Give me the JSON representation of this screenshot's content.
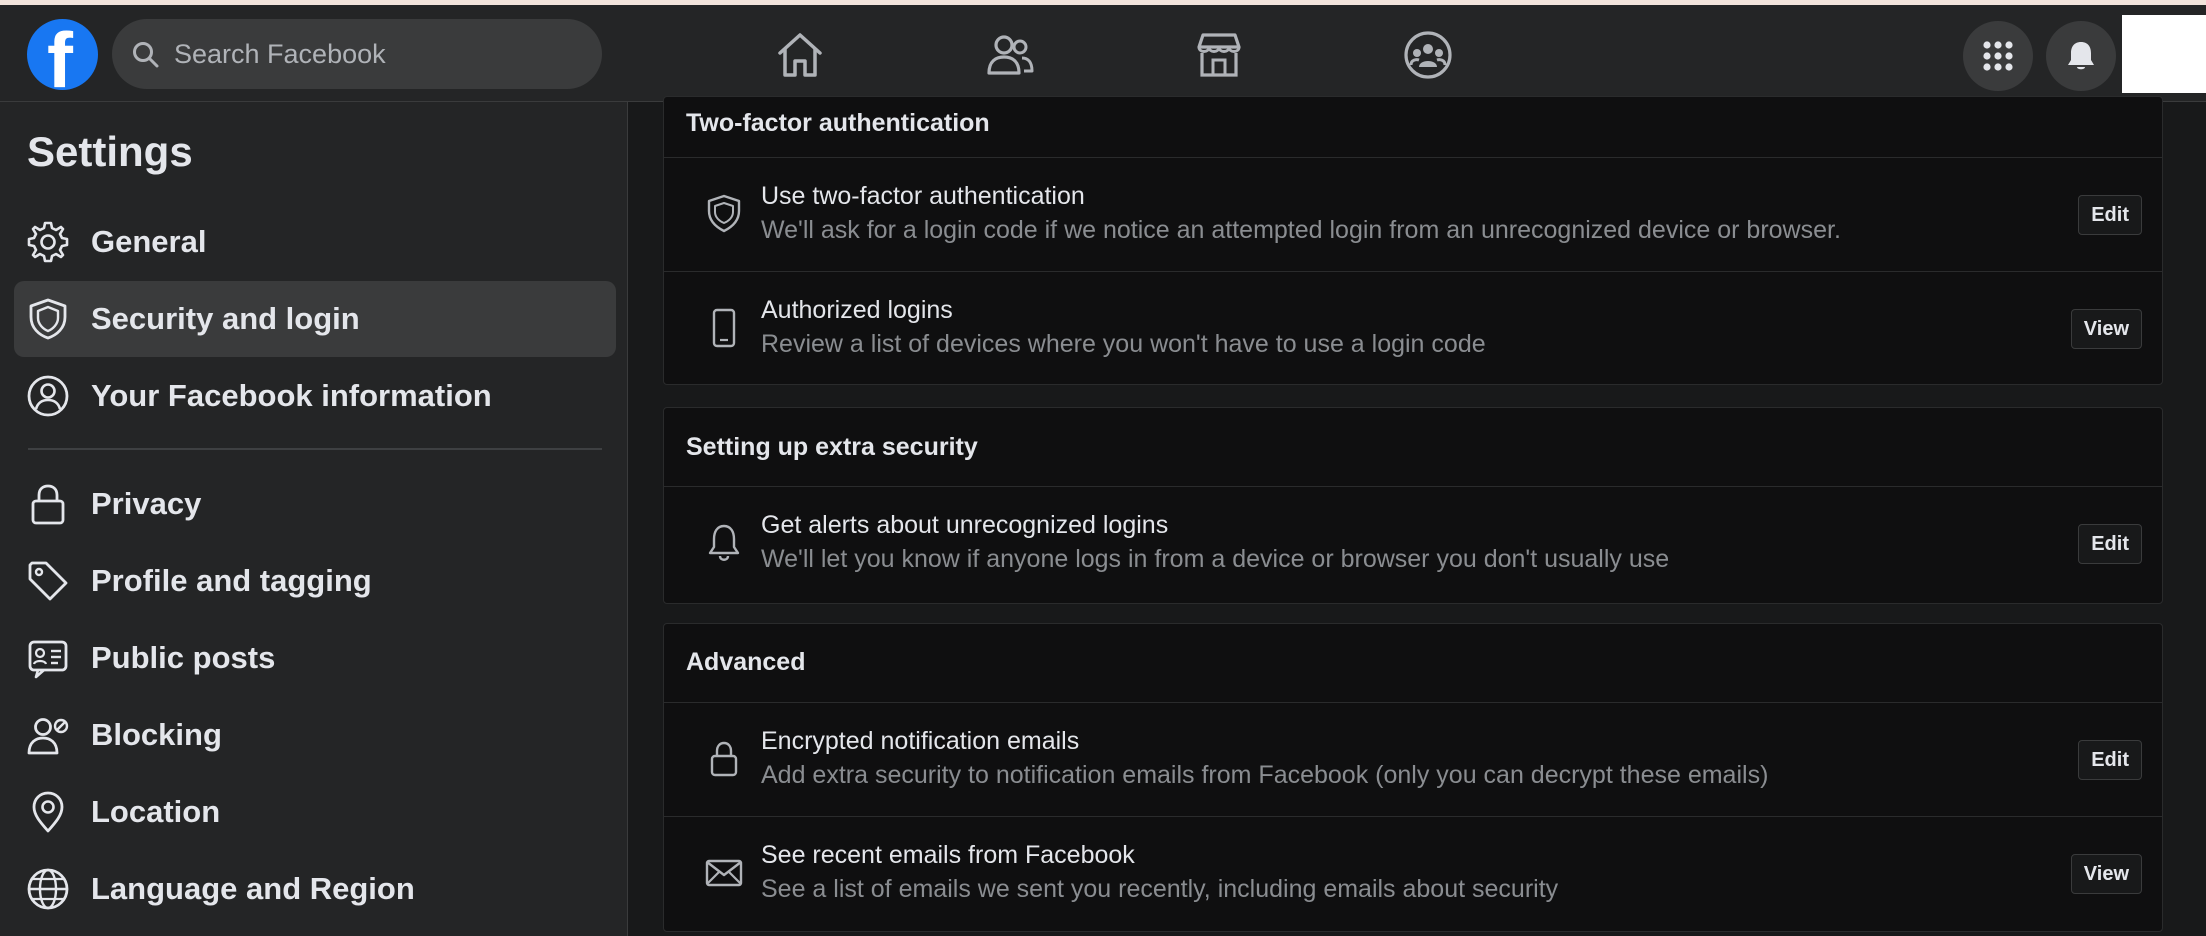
{
  "header": {
    "logo_letter": "f",
    "search_placeholder": "Search Facebook",
    "nav_icons": [
      "home-icon",
      "friends-icon",
      "marketplace-icon",
      "groups-icon"
    ],
    "right_icons": [
      "menu-grid-icon",
      "notifications-bell-icon"
    ]
  },
  "sidebar": {
    "title": "Settings",
    "items": [
      {
        "label": "General",
        "icon": "gear-icon"
      },
      {
        "label": "Security and login",
        "icon": "shield-icon",
        "active": true
      },
      {
        "label": "Your Facebook information",
        "icon": "user-circle-icon"
      },
      {
        "label": "Privacy",
        "icon": "lock-icon"
      },
      {
        "label": "Profile and tagging",
        "icon": "tag-icon"
      },
      {
        "label": "Public posts",
        "icon": "public-posts-icon"
      },
      {
        "label": "Blocking",
        "icon": "block-user-icon"
      },
      {
        "label": "Location",
        "icon": "location-pin-icon"
      },
      {
        "label": "Language and Region",
        "icon": "globe-icon"
      }
    ]
  },
  "sections": [
    {
      "title": "Two-factor authentication",
      "rows": [
        {
          "title": "Use two-factor authentication",
          "subtitle": "We'll ask for a login code if we notice an attempted login from an unrecognized device or browser.",
          "button": "Edit",
          "icon": "shield-icon"
        },
        {
          "title": "Authorized logins",
          "subtitle": "Review a list of devices where you won't have to use a login code",
          "button": "View",
          "icon": "phone-icon"
        }
      ]
    },
    {
      "title": "Setting up extra security",
      "rows": [
        {
          "title": "Get alerts about unrecognized logins",
          "subtitle": "We'll let you know if anyone logs in from a device or browser you don't usually use",
          "button": "Edit",
          "icon": "bell-icon"
        }
      ]
    },
    {
      "title": "Advanced",
      "rows": [
        {
          "title": "Encrypted notification emails",
          "subtitle": "Add extra security to notification emails from Facebook (only you can decrypt these emails)",
          "button": "Edit",
          "icon": "lock-icon"
        },
        {
          "title": "See recent emails from Facebook",
          "subtitle": "See a list of emails we sent you recently, including emails about security",
          "button": "View",
          "icon": "envelope-icon"
        }
      ]
    }
  ]
}
